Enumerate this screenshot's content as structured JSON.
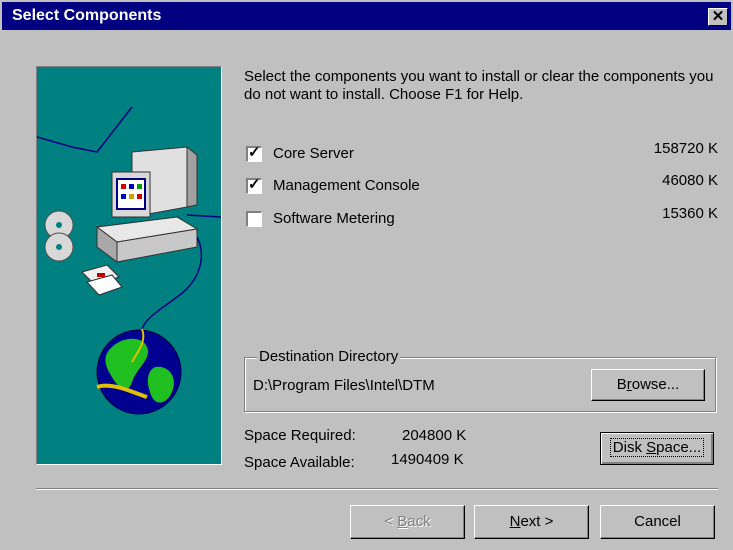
{
  "window": {
    "title": "Select Components",
    "close_glyph": "✕"
  },
  "intro": "Select the components you want to install or clear the components you do not want to install.  Choose F1 for Help.",
  "components": [
    {
      "label": "Core Server",
      "size": "158720 K",
      "checked": true
    },
    {
      "label": "Management Console",
      "size": "46080 K",
      "checked": true
    },
    {
      "label": "Software Metering",
      "size": "15360 K",
      "checked": false
    }
  ],
  "destination": {
    "legend": "Destination Directory",
    "path": "D:\\Program Files\\Intel\\DTM"
  },
  "buttons": {
    "browse": {
      "pre": "B",
      "u": "r",
      "post": "owse..."
    },
    "disk_space": {
      "pre": "Disk ",
      "u": "S",
      "post": "pace..."
    },
    "back": {
      "pre": "< ",
      "u": "B",
      "post": "ack"
    },
    "next": {
      "pre": "",
      "u": "N",
      "post": "ext >"
    },
    "cancel": "Cancel"
  },
  "space": {
    "required_label": "Space Required:",
    "required_value": "204800 K",
    "available_label": "Space Available:",
    "available_value": "1490409 K"
  },
  "icons": {
    "checkbox_mark": "✓",
    "art": "computer-globe-illustration"
  },
  "colors": {
    "titlebar": "#000080",
    "art_bg": "#008080",
    "face": "#c0c0c0"
  }
}
